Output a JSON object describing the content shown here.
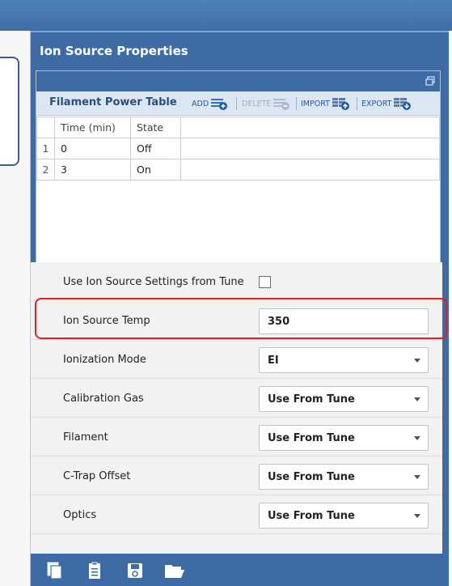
{
  "panel": {
    "title": "Ion Source Properties"
  },
  "table": {
    "title": "Filament Power Table",
    "toolbar": {
      "add": "ADD",
      "delete": "DELETE",
      "import": "IMPORT",
      "export": "EXPORT"
    },
    "columns": [
      "Time (min)",
      "State"
    ],
    "rows": [
      {
        "num": "1",
        "time": "0",
        "state": "Off"
      },
      {
        "num": "2",
        "time": "3",
        "state": "On"
      }
    ]
  },
  "properties": {
    "use_tune": {
      "label": "Use Ion Source Settings from Tune",
      "checked": false
    },
    "ion_temp": {
      "label": "Ion Source Temp",
      "value": "350"
    },
    "ionization_mode": {
      "label": "Ionization Mode",
      "value": "EI"
    },
    "calibration_gas": {
      "label": "Calibration Gas",
      "value": "Use From Tune"
    },
    "filament": {
      "label": "Filament",
      "value": "Use From Tune"
    },
    "ctrap_offset": {
      "label": "C-Trap Offset",
      "value": "Use From Tune"
    },
    "optics": {
      "label": "Optics",
      "value": "Use From Tune"
    }
  },
  "icons": {
    "bottom": [
      "copy-icon",
      "clipboard-icon",
      "save-icon",
      "folder-open-icon"
    ]
  },
  "colors": {
    "header_blue": "#3e6ba3",
    "highlight_red": "#e01e26",
    "link_blue": "#1f5aa6"
  }
}
